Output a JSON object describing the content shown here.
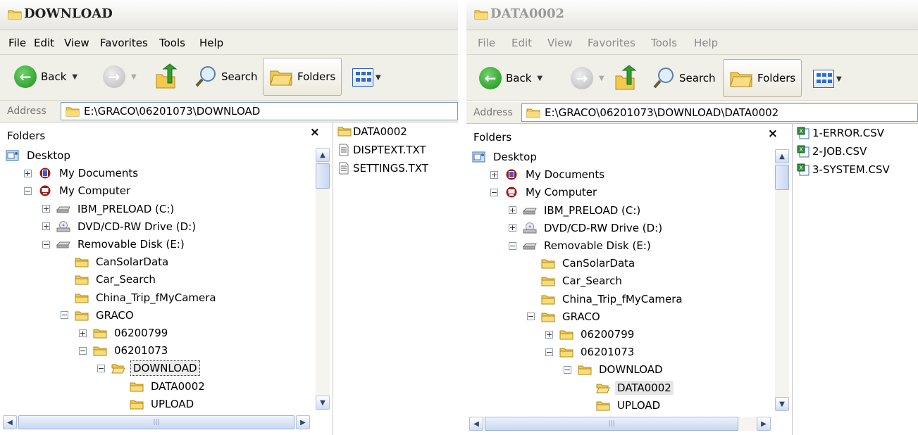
{
  "window1": {
    "title": "DOWNLOAD",
    "menu": [
      "File",
      "Edit",
      "View",
      "Favorites",
      "Tools",
      "Help"
    ],
    "toolbar": {
      "back": "Back",
      "search": "Search",
      "folders": "Folders"
    },
    "address": {
      "label": "Address",
      "path": "E:\\GRACO\\06201073\\DOWNLOAD"
    },
    "folders_pane": {
      "title": "Folders",
      "close": "×"
    },
    "tree": [
      {
        "label": "Desktop",
        "expander": "",
        "icon": "desktop-icon"
      },
      {
        "label": "My Documents",
        "expander": "+",
        "icon": "my-documents-icon"
      },
      {
        "label": "My Computer",
        "expander": "−",
        "icon": "my-computer-icon"
      },
      {
        "label": "IBM_PRELOAD (C:)",
        "expander": "+",
        "icon": "hard-drive-icon"
      },
      {
        "label": "DVD/CD-RW Drive (D:)",
        "expander": "+",
        "icon": "dvd-drive-icon"
      },
      {
        "label": "Removable Disk (E:)",
        "expander": "−",
        "icon": "removable-disk-icon"
      },
      {
        "label": "CanSolarData",
        "expander": "",
        "icon": "folder-icon"
      },
      {
        "label": "Car_Search",
        "expander": "",
        "icon": "folder-icon"
      },
      {
        "label": "China_Trip_fMyCamera",
        "expander": "",
        "icon": "folder-icon"
      },
      {
        "label": "GRACO",
        "expander": "−",
        "icon": "folder-icon"
      },
      {
        "label": "06200799",
        "expander": "+",
        "icon": "folder-icon"
      },
      {
        "label": "06201073",
        "expander": "−",
        "icon": "folder-icon"
      },
      {
        "label": "DOWNLOAD",
        "expander": "−",
        "icon": "open-folder-icon"
      },
      {
        "label": "DATA0002",
        "expander": "",
        "icon": "folder-icon"
      },
      {
        "label": "UPLOAD",
        "expander": "",
        "icon": "folder-icon"
      }
    ],
    "selected_folder": "DOWNLOAD",
    "files": [
      {
        "name": "DATA0002",
        "icon": "folder-icon"
      },
      {
        "name": "DISPTEXT.TXT",
        "icon": "text-file-icon"
      },
      {
        "name": "SETTINGS.TXT",
        "icon": "text-file-icon"
      }
    ]
  },
  "window2": {
    "title": "DATA0002",
    "menu": [
      "File",
      "Edit",
      "View",
      "Favorites",
      "Tools",
      "Help"
    ],
    "toolbar": {
      "back": "Back",
      "search": "Search",
      "folders": "Folders"
    },
    "address": {
      "label": "Address",
      "path": "E:\\GRACO\\06201073\\DOWNLOAD\\DATA0002"
    },
    "folders_pane": {
      "title": "Folders",
      "close": "×"
    },
    "tree": [
      {
        "label": "Desktop",
        "expander": "",
        "icon": "desktop-icon"
      },
      {
        "label": "My Documents",
        "expander": "+",
        "icon": "my-documents-icon"
      },
      {
        "label": "My Computer",
        "expander": "−",
        "icon": "my-computer-icon"
      },
      {
        "label": "IBM_PRELOAD (C:)",
        "expander": "+",
        "icon": "hard-drive-icon"
      },
      {
        "label": "DVD/CD-RW Drive (D:)",
        "expander": "+",
        "icon": "dvd-drive-icon"
      },
      {
        "label": "Removable Disk (E:)",
        "expander": "−",
        "icon": "removable-disk-icon"
      },
      {
        "label": "CanSolarData",
        "expander": "",
        "icon": "folder-icon"
      },
      {
        "label": "Car_Search",
        "expander": "",
        "icon": "folder-icon"
      },
      {
        "label": "China_Trip_fMyCamera",
        "expander": "",
        "icon": "folder-icon"
      },
      {
        "label": "GRACO",
        "expander": "−",
        "icon": "folder-icon"
      },
      {
        "label": "06200799",
        "expander": "+",
        "icon": "folder-icon"
      },
      {
        "label": "06201073",
        "expander": "−",
        "icon": "folder-icon"
      },
      {
        "label": "DOWNLOAD",
        "expander": "−",
        "icon": "folder-icon"
      },
      {
        "label": "DATA0002",
        "expander": "",
        "icon": "open-folder-icon"
      },
      {
        "label": "UPLOAD",
        "expander": "",
        "icon": "folder-icon"
      }
    ],
    "selected_folder": "DATA0002",
    "files": [
      {
        "name": "1-ERROR.CSV",
        "icon": "excel-csv-icon"
      },
      {
        "name": "2-JOB.CSV",
        "icon": "excel-csv-icon"
      },
      {
        "name": "3-SYSTEM.CSV",
        "icon": "excel-csv-icon"
      }
    ]
  },
  "colors": {
    "titlebar": "#e9e8e3",
    "chrome": "#f0efe8",
    "back_green": "#2a9a2a",
    "folder_yellow": "#f2c94c",
    "selection": "#e6e6e6"
  }
}
